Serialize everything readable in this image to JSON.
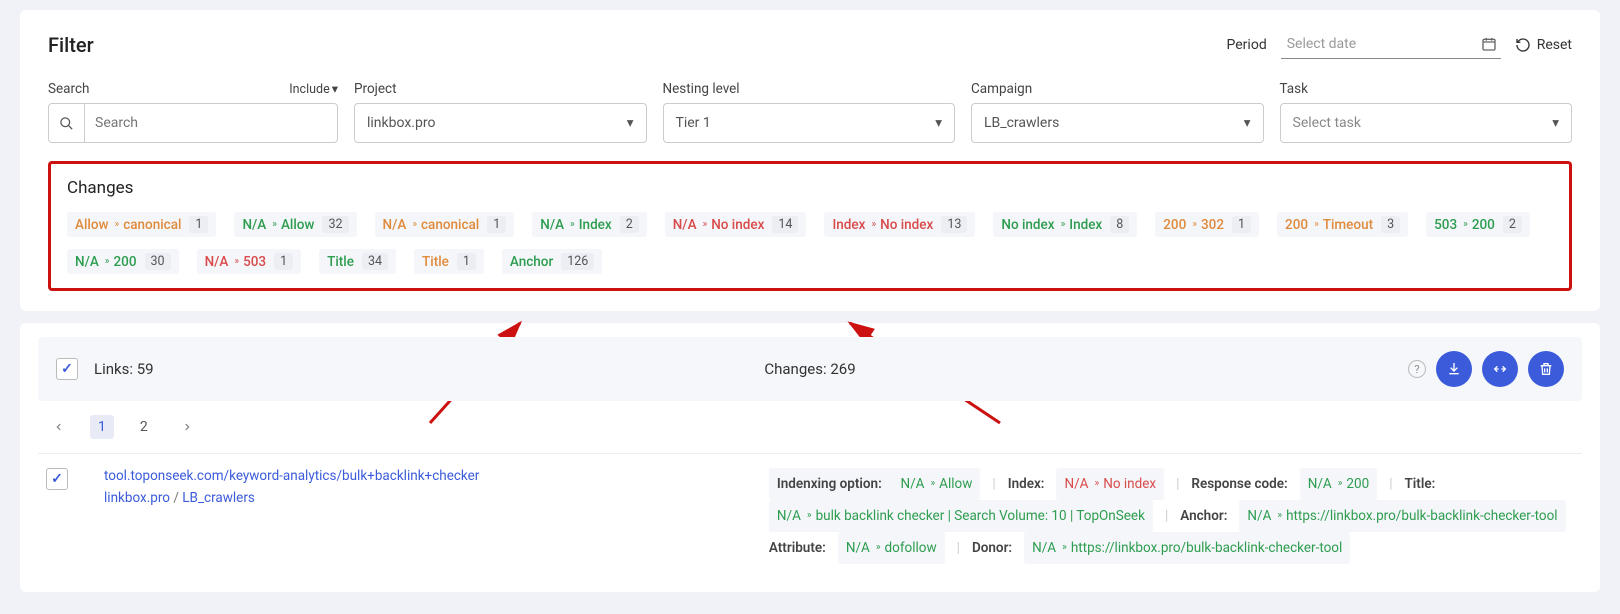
{
  "filter": {
    "title": "Filter",
    "period_label": "Period",
    "date_placeholder": "Select date",
    "reset_label": "Reset",
    "search_label": "Search",
    "include_label": "Include",
    "search_placeholder": "Search",
    "project_label": "Project",
    "project_value": "linkbox.pro",
    "nesting_label": "Nesting level",
    "nesting_value": "Tier 1",
    "campaign_label": "Campaign",
    "campaign_value": "LB_crawlers",
    "task_label": "Task",
    "task_placeholder": "Select task"
  },
  "changes": {
    "title": "Changes",
    "chips": [
      {
        "from": "Allow",
        "from_color": "c-orange",
        "to": "canonical",
        "to_color": "c-orange",
        "count": "1"
      },
      {
        "from": "N/A",
        "from_color": "c-green",
        "to": "Allow",
        "to_color": "c-green",
        "count": "32"
      },
      {
        "from": "N/A",
        "from_color": "c-orange",
        "to": "canonical",
        "to_color": "c-orange",
        "count": "1"
      },
      {
        "from": "N/A",
        "from_color": "c-green",
        "to": "Index",
        "to_color": "c-green",
        "count": "2"
      },
      {
        "from": "N/A",
        "from_color": "c-red",
        "to": "No index",
        "to_color": "c-red",
        "count": "14"
      },
      {
        "from": "Index",
        "from_color": "c-red",
        "to": "No index",
        "to_color": "c-red",
        "count": "13"
      },
      {
        "from": "No index",
        "from_color": "c-green",
        "to": "Index",
        "to_color": "c-green",
        "count": "8"
      },
      {
        "from": "200",
        "from_color": "c-orange",
        "to": "302",
        "to_color": "c-orange",
        "count": "1"
      },
      {
        "from": "200",
        "from_color": "c-orange",
        "to": "Timeout",
        "to_color": "c-orange",
        "count": "3"
      },
      {
        "from": "503",
        "from_color": "c-green",
        "to": "200",
        "to_color": "c-green",
        "count": "2"
      },
      {
        "from": "N/A",
        "from_color": "c-green",
        "to": "200",
        "to_color": "c-green",
        "count": "30"
      },
      {
        "from": "N/A",
        "from_color": "c-red",
        "to": "503",
        "to_color": "c-red",
        "count": "1"
      },
      {
        "label": "Title",
        "label_color": "c-green",
        "count": "34"
      },
      {
        "label": "Title",
        "label_color": "c-orange",
        "count": "1"
      },
      {
        "label": "Anchor",
        "label_color": "c-green",
        "count": "126"
      }
    ]
  },
  "links_bar": {
    "links_label": "Links:",
    "links_count": "59",
    "changes_label": "Changes:",
    "changes_count": "269"
  },
  "pager": {
    "pages": [
      "1",
      "2"
    ],
    "active": 0
  },
  "result": {
    "url": "tool.toponseek.com/keyword-analytics/bulk+backlink+checker",
    "crumb_left": "linkbox.pro",
    "crumb_right": "LB_crawlers",
    "indexing_label": "Indenxing option:",
    "idx_from": "N/A",
    "idx_to": "Allow",
    "index_label": "Index:",
    "index_from": "N/A",
    "index_to": "No index",
    "resp_label": "Response code:",
    "resp_from": "N/A",
    "resp_to": "200",
    "title_label": "Title:",
    "title_from": "N/A",
    "title_to": "bulk backlink checker | Search Volume: 10 | TopOnSeek",
    "anchor_label": "Anchor:",
    "anchor_from": "N/A",
    "anchor_to": "https://linkbox.pro/bulk-backlink-checker-tool",
    "attribute_label": "Attribute:",
    "attr_from": "N/A",
    "attr_to": "dofollow",
    "donor_label": "Donor:",
    "donor_from": "N/A",
    "donor_to": "https://linkbox.pro/bulk-backlink-checker-tool"
  }
}
